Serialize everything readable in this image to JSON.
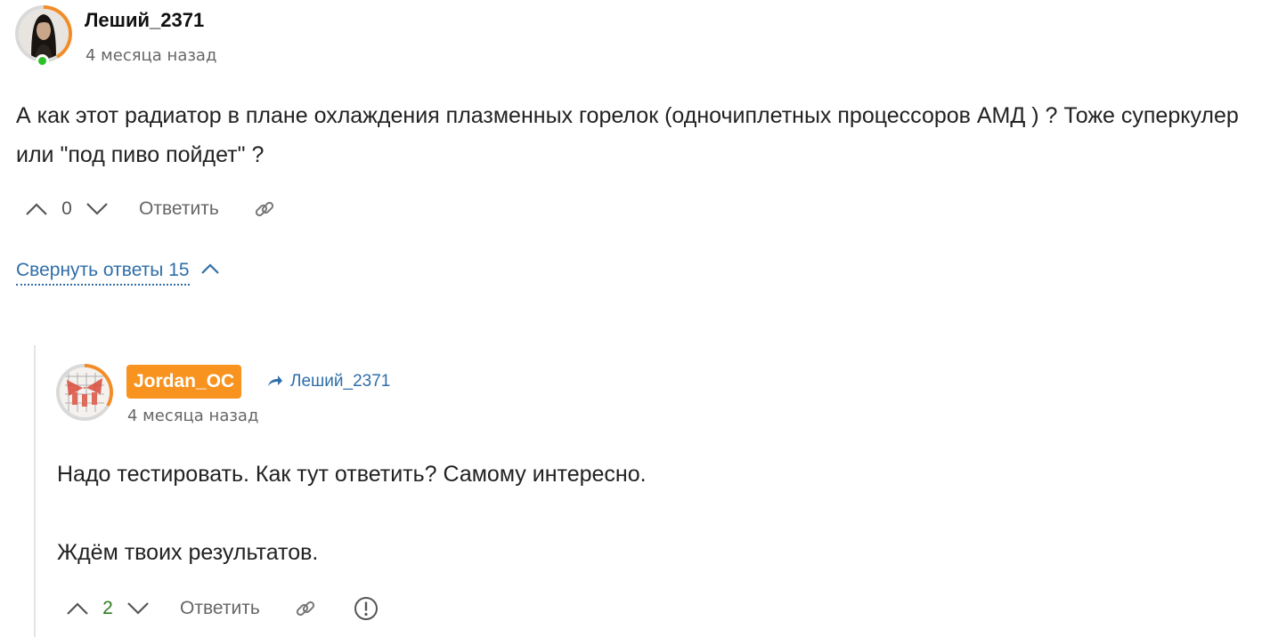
{
  "comment": {
    "author": "Леший_2371",
    "time": "4 месяца назад",
    "text": "А как этот радиатор в плане охлаждения плазменных горелок (одночиплетных процессоров АМД ) ? Тоже суперкулер или \"под пиво пойдет\" ?",
    "score": "0",
    "reply_label": "Ответить",
    "collapse_label": "Свернуть ответы 15"
  },
  "reply": {
    "author": "Jordan_OC",
    "reply_to": "Леший_2371",
    "time": "4 месяца назад",
    "paragraphs": [
      "Надо тестировать. Как тут ответить? Самому интересно.",
      "Ждём твоих результатов."
    ],
    "score": "2",
    "reply_label": "Ответить"
  },
  "colors": {
    "accent_orange": "#f7931e",
    "link_blue": "#2f6ea8",
    "online_green": "#2ec127",
    "positive_score": "#2e7d1f"
  },
  "icons": [
    "upvote-icon",
    "downvote-icon",
    "link-icon",
    "report-icon",
    "reply-arrow-icon",
    "chevron-up-icon"
  ]
}
